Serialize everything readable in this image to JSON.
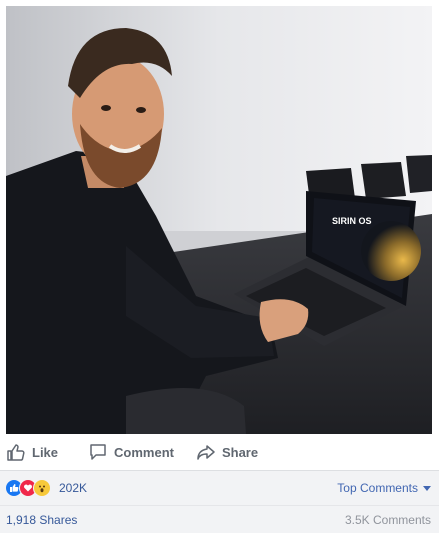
{
  "post": {
    "actions": {
      "like_label": "Like",
      "comment_label": "Comment",
      "share_label": "Share"
    },
    "reactions": {
      "icons": [
        "like-reaction-icon",
        "love-reaction-icon",
        "wow-reaction-icon"
      ],
      "count": "202K",
      "top_comments_label": "Top Comments"
    },
    "stats": {
      "shares": "1,918 Shares",
      "comments": "3.5K Comments"
    }
  },
  "photo": {
    "laptop_screen_text": "SIRIN OS"
  },
  "colors": {
    "link_blue": "#365899",
    "accent_blue": "#4267b2",
    "action_gray": "#606770",
    "row_bg": "#f2f3f5"
  }
}
